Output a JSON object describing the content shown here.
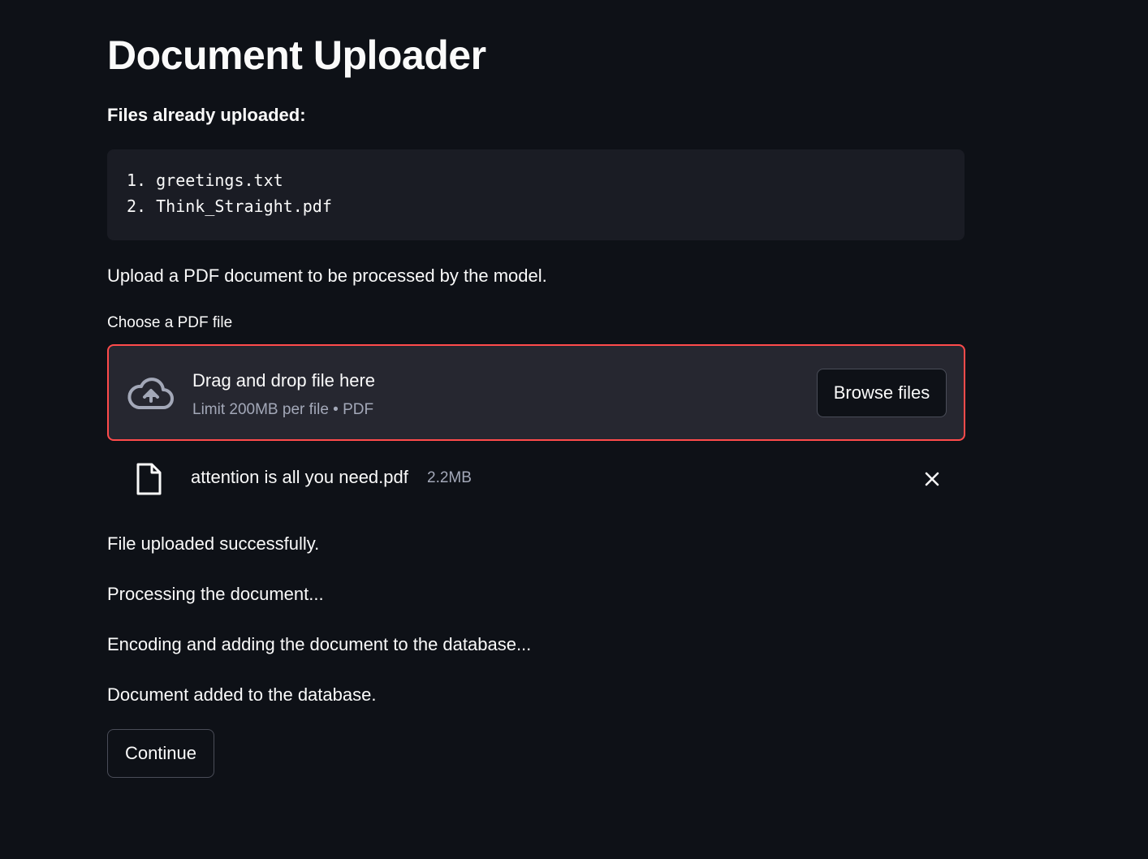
{
  "header": {
    "title": "Document Uploader"
  },
  "uploaded_files": {
    "heading": "Files already uploaded:",
    "items": [
      "1. greetings.txt",
      "2. Think_Straight.pdf"
    ]
  },
  "instructions": "Upload a PDF document to be processed by the model.",
  "uploader": {
    "label": "Choose a PDF file",
    "drop_title": "Drag and drop file here",
    "drop_limit": "Limit 200MB per file • PDF",
    "browse_label": "Browse files",
    "icon": "cloud-upload-icon",
    "border_color": "#ff4b4b"
  },
  "selected_file": {
    "name": "attention is all you need.pdf",
    "size": "2.2MB",
    "icon": "file-icon",
    "remove_icon": "close-icon"
  },
  "status_messages": [
    "File uploaded successfully.",
    "Processing the document...",
    "Encoding and adding the document to the database...",
    "Document added to the database."
  ],
  "continue_label": "Continue",
  "colors": {
    "background": "#0e1117",
    "surface": "#262730",
    "code_background": "#1a1c24",
    "accent": "#ff4b4b",
    "muted_text": "#a3a8b8"
  }
}
